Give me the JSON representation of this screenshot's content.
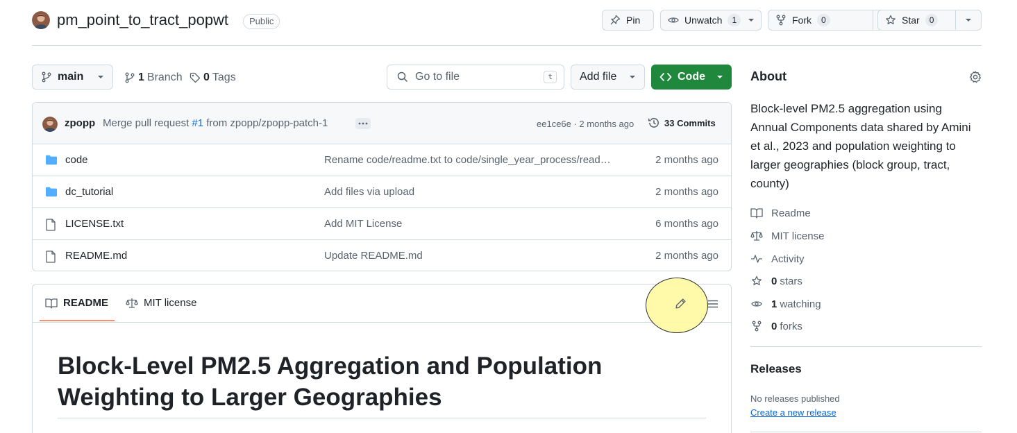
{
  "repo": {
    "name": "pm_point_to_tract_popwt",
    "visibility": "Public",
    "pin_label": "Pin",
    "watch_label": "Unwatch",
    "watch_count": "1",
    "fork_label": "Fork",
    "fork_count": "0",
    "star_label": "Star",
    "star_count": "0"
  },
  "toolbar": {
    "branch": "main",
    "branch_count": "1",
    "branch_label": "Branch",
    "tag_count": "0",
    "tag_label": "Tags",
    "search_placeholder": "Go to file",
    "search_shortcut": "t",
    "add_file_label": "Add file",
    "code_label": "Code"
  },
  "latest_commit": {
    "user": "zpopp",
    "message_prefix": "Merge pull request",
    "pr_link": "#1",
    "message_suffix": "from zpopp/zpopp-patch-1",
    "meta": "ee1ce6e · 2 months ago",
    "commits_label": "33 Commits"
  },
  "files": [
    {
      "name": "code",
      "type": "folder",
      "message": "Rename code/readme.txt to code/single_year_process/read…",
      "date": "2 months ago"
    },
    {
      "name": "dc_tutorial",
      "type": "folder",
      "message": "Add files via upload",
      "date": "2 months ago"
    },
    {
      "name": "LICENSE.txt",
      "type": "file",
      "message": "Add MIT License",
      "date": "6 months ago"
    },
    {
      "name": "README.md",
      "type": "file",
      "message": "Update README.md",
      "date": "2 months ago"
    }
  ],
  "readme": {
    "tab_readme": "README",
    "tab_license": "MIT license",
    "title": "Block-Level PM2.5 Aggregation and Population Weighting to Larger Geographies"
  },
  "about": {
    "title": "About",
    "description": "Block-level PM2.5 aggregation using Annual Components data shared by Amini et al., 2023 and population weighting to larger geographies (block group, tract, county)",
    "readme_label": "Readme",
    "license_label": "MIT license",
    "activity_label": "Activity",
    "stars_count": "0",
    "stars_label": "stars",
    "watching_count": "1",
    "watching_label": "watching",
    "forks_count": "0",
    "forks_label": "forks"
  },
  "releases": {
    "title": "Releases",
    "none_text": "No releases published",
    "create_link": "Create a new release"
  },
  "colors": {
    "accent_green": "#1f883d",
    "link_blue": "#0969da",
    "tab_underline": "#fd8c73",
    "highlight_yellow": "#fff9a6"
  }
}
